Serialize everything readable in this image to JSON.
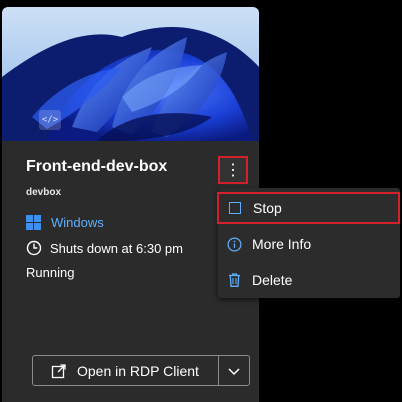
{
  "card": {
    "title": "Front-end-dev-box",
    "subtitle": "devbox",
    "os_label": "Windows",
    "shutdown_label": "Shuts down at 6:30 pm",
    "status_label": "Running",
    "hero_badge": "</>"
  },
  "kebab_label": "⋮",
  "menu": {
    "items": [
      {
        "label": "Stop",
        "icon": "stop-icon"
      },
      {
        "label": "More Info",
        "icon": "info-icon"
      },
      {
        "label": "Delete",
        "icon": "trash-icon"
      }
    ]
  },
  "rdp_button": {
    "label": "Open in RDP Client",
    "icon": "open-external-icon",
    "dropdown_icon": "chevron-down-icon"
  },
  "colors": {
    "accent_blue": "#5eb0ff",
    "highlight_red": "#d4202a",
    "card_bg": "#2b2b2b",
    "menu_bg": "#2c2c2c"
  }
}
